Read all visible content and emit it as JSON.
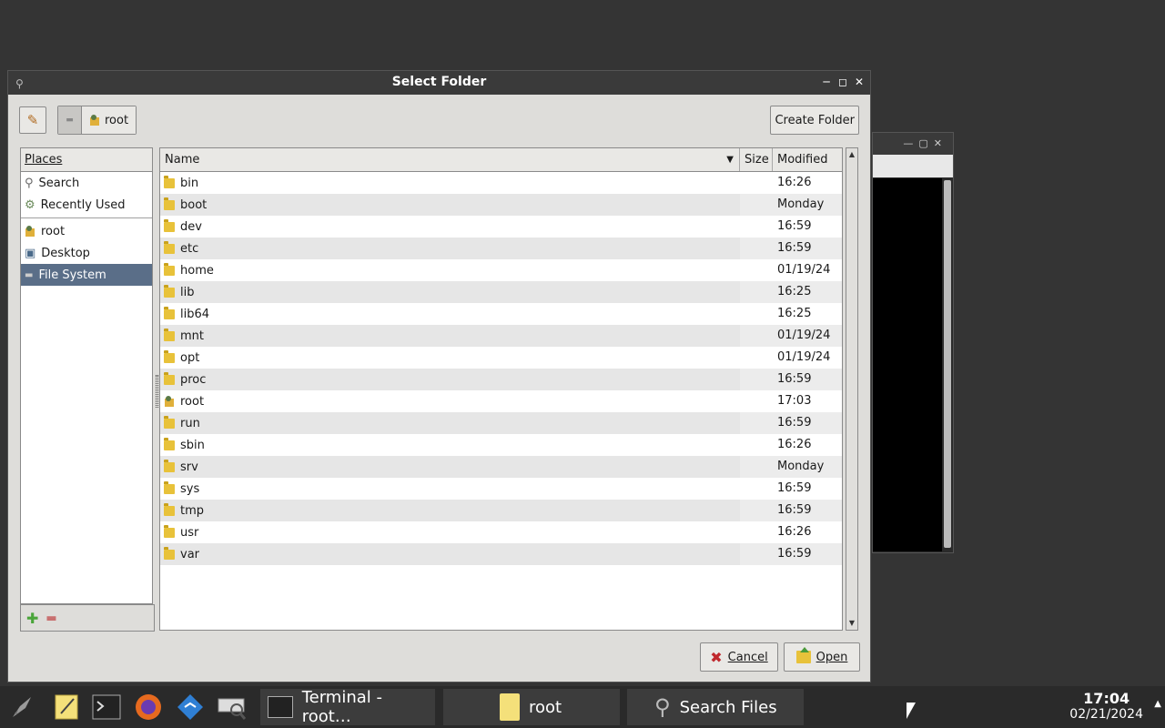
{
  "dialog": {
    "title": "Select Folder",
    "create_folder_label": "Create Folder",
    "path_root": "root",
    "cancel_label": "Cancel",
    "open_label": "Open"
  },
  "places": {
    "header": "Places",
    "items": [
      {
        "label": "Search",
        "icon": "search-icon"
      },
      {
        "label": "Recently Used",
        "icon": "recent-icon"
      },
      {
        "label": "root",
        "icon": "home-icon"
      },
      {
        "label": "Desktop",
        "icon": "desktop-icon"
      },
      {
        "label": "File System",
        "icon": "drive-icon",
        "selected": true
      }
    ]
  },
  "files": {
    "columns": {
      "name": "Name",
      "size": "Size",
      "modified": "Modified"
    },
    "rows": [
      {
        "name": "bin",
        "modified": "16:26"
      },
      {
        "name": "boot",
        "modified": "Monday"
      },
      {
        "name": "dev",
        "modified": "16:59"
      },
      {
        "name": "etc",
        "modified": "16:59"
      },
      {
        "name": "home",
        "modified": "01/19/24"
      },
      {
        "name": "lib",
        "modified": "16:25"
      },
      {
        "name": "lib64",
        "modified": "16:25"
      },
      {
        "name": "mnt",
        "modified": "01/19/24"
      },
      {
        "name": "opt",
        "modified": "01/19/24"
      },
      {
        "name": "proc",
        "modified": "16:59"
      },
      {
        "name": "root",
        "modified": "17:03",
        "home": true
      },
      {
        "name": "run",
        "modified": "16:59"
      },
      {
        "name": "sbin",
        "modified": "16:26"
      },
      {
        "name": "srv",
        "modified": "Monday"
      },
      {
        "name": "sys",
        "modified": "16:59"
      },
      {
        "name": "tmp",
        "modified": "16:59"
      },
      {
        "name": "usr",
        "modified": "16:26"
      },
      {
        "name": "var",
        "modified": "16:59"
      }
    ]
  },
  "taskbar": {
    "tasks": [
      {
        "label": "Terminal - root…",
        "icon": "terminal-icon"
      },
      {
        "label": "root",
        "icon": "folder-icon"
      },
      {
        "label": "Search Files",
        "icon": "search-icon"
      }
    ],
    "time": "17:04",
    "date": "02/21/2024"
  }
}
